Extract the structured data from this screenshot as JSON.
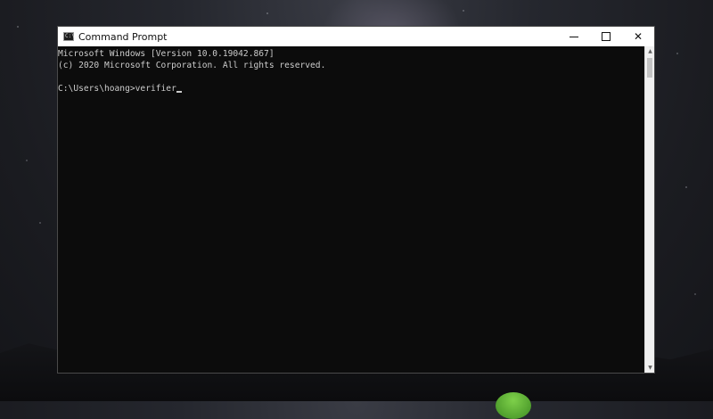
{
  "window": {
    "title": "Command Prompt",
    "icon": "console-icon",
    "controls": {
      "minimize_icon": "minimize-icon",
      "maximize_icon": "maximize-icon",
      "close_icon": "close-icon",
      "close_glyph": "✕"
    }
  },
  "console": {
    "lines": [
      "Microsoft Windows [Version 10.0.19042.867]",
      "(c) 2020 Microsoft Corporation. All rights reserved.",
      "",
      "C:\\Users\\hoang>verifier"
    ]
  },
  "scrollbar": {
    "up_glyph": "▲",
    "down_glyph": "▼"
  },
  "colors": {
    "console_bg": "#0c0c0c",
    "console_text": "#cccccc",
    "titlebar_bg": "#ffffff"
  }
}
